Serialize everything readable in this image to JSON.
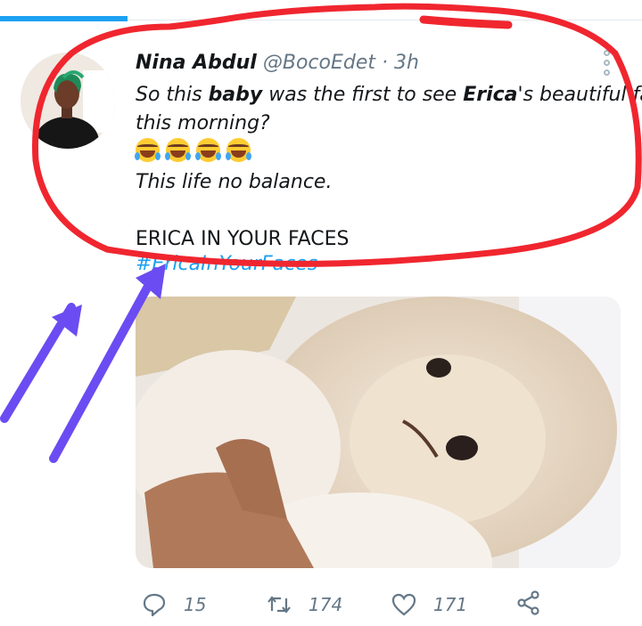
{
  "tweet": {
    "author_name": "Nina Abdul",
    "handle": "@BocoEdet",
    "separator": "·",
    "time": "3h",
    "text_line1_a": "So this ",
    "text_line1_b": "baby",
    "text_line1_c": " was the first to see ",
    "text_line1_d": "Erica",
    "text_line1_e": "'s beautiful face",
    "text_line2": "this morning?",
    "text_line3": "This life no balance.",
    "text_line4_a": "ERICA",
    "text_line4_b": " IN YOUR FACES",
    "hashtag": "#EricaInYourFaces",
    "emoji_count": 4
  },
  "actions": {
    "replies": "15",
    "retweets": "174",
    "likes": "171"
  },
  "icons": {
    "reply": "reply-icon",
    "retweet": "retweet-icon",
    "like": "heart-icon",
    "share": "share-icon",
    "more": "more-options-icon"
  },
  "colors": {
    "accent": "#1da1f2",
    "annotation_red": "#f0262f",
    "annotation_arrow": "#6b4cf2",
    "muted": "#657786"
  }
}
